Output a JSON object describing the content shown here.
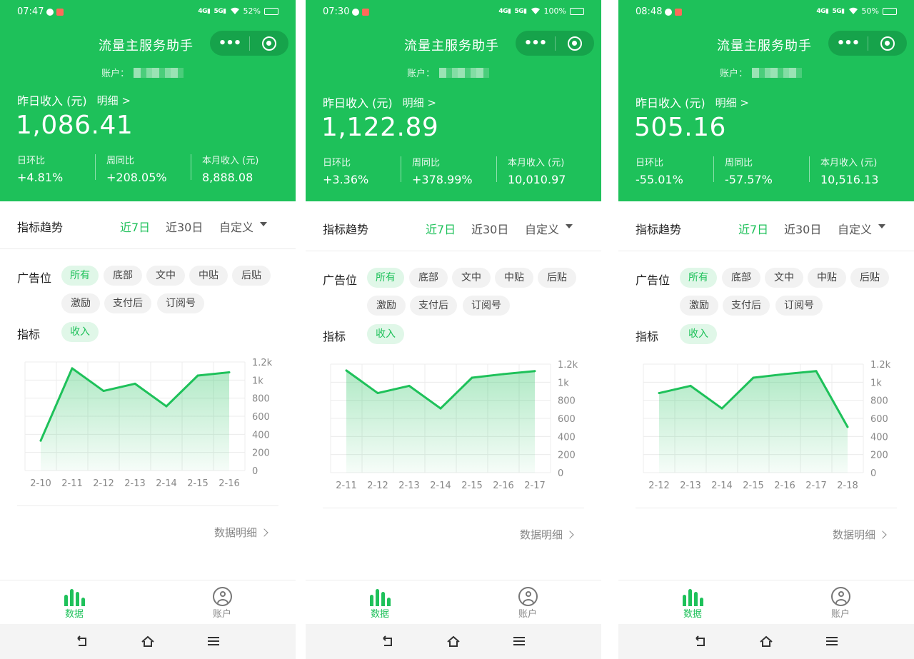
{
  "common": {
    "title": "流量主服务助手",
    "capsule_more": "•••",
    "account_label": "账户：",
    "yesterday_label": "昨日收入 (元)",
    "detail_link": "明细 >",
    "stat_labels": [
      "日环比",
      "周同比",
      "本月收入 (元)"
    ],
    "trend_label": "指标趋势",
    "range_options": [
      "近7日",
      "近30日",
      "自定义"
    ],
    "ad_slot_label": "广告位",
    "ad_slots": [
      "所有",
      "底部",
      "文中",
      "中贴",
      "后贴",
      "激励",
      "支付后",
      "订阅号"
    ],
    "metric_label": "指标",
    "metric_value": "收入",
    "y_ticks": [
      "1.2k",
      "1k",
      "800",
      "600",
      "400",
      "200",
      "0"
    ],
    "data_detail": "数据明细",
    "tab_data": "数据",
    "tab_account": "账户",
    "accent_color": "#1ec15a"
  },
  "screens": [
    {
      "status_time": "07:47",
      "battery": "52%",
      "yesterday_income": "1,086.41",
      "day_ratio": "+4.81%",
      "week_ratio": "+208.05%",
      "month_income": "8,888.08"
    },
    {
      "status_time": "07:30",
      "battery": "100%",
      "yesterday_income": "1,122.89",
      "day_ratio": "+3.36%",
      "week_ratio": "+378.99%",
      "month_income": "10,010.97"
    },
    {
      "status_time": "08:48",
      "battery": "50%",
      "yesterday_income": "505.16",
      "day_ratio": "-55.01%",
      "week_ratio": "-57.57%",
      "month_income": "10,516.13"
    }
  ],
  "chart_data": [
    {
      "type": "area",
      "categories": [
        "2-10",
        "2-11",
        "2-12",
        "2-13",
        "2-14",
        "2-15",
        "2-16"
      ],
      "values": [
        330,
        1130,
        880,
        960,
        710,
        1050,
        1086
      ],
      "ylim": [
        0,
        1200
      ],
      "grid": true
    },
    {
      "type": "area",
      "categories": [
        "2-11",
        "2-12",
        "2-13",
        "2-14",
        "2-15",
        "2-16",
        "2-17"
      ],
      "values": [
        1130,
        880,
        960,
        710,
        1050,
        1090,
        1123
      ],
      "ylim": [
        0,
        1200
      ],
      "grid": true
    },
    {
      "type": "area",
      "categories": [
        "2-12",
        "2-13",
        "2-14",
        "2-15",
        "2-16",
        "2-17",
        "2-18"
      ],
      "values": [
        880,
        960,
        710,
        1050,
        1090,
        1123,
        505
      ],
      "ylim": [
        0,
        1200
      ],
      "grid": true
    }
  ]
}
